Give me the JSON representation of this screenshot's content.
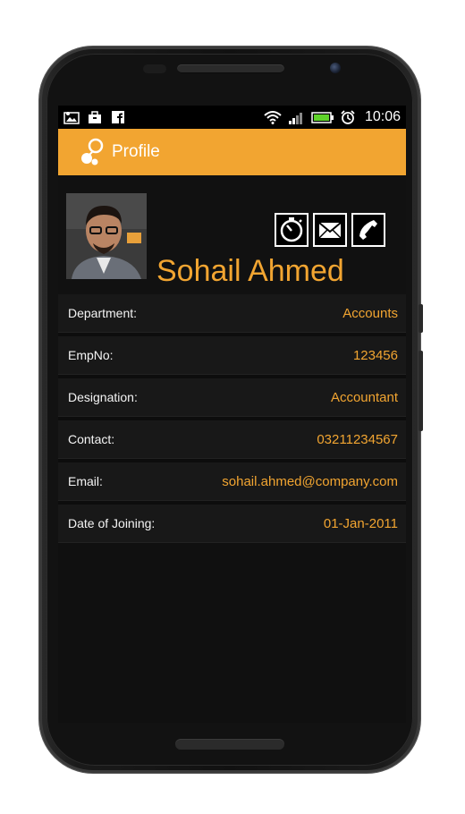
{
  "status_bar": {
    "time": "10:06",
    "left_icons": [
      "photo-notification-icon",
      "briefcase-notification-icon",
      "facebook-icon"
    ],
    "right_icons": [
      "wifi-icon",
      "signal-icon",
      "battery-icon",
      "alarm-icon"
    ]
  },
  "action_bar": {
    "title": "Profile",
    "color": "#f2a531"
  },
  "profile": {
    "name": "Sohail Ahmed",
    "actions": [
      "timer-icon",
      "email-icon",
      "phone-icon"
    ]
  },
  "details": [
    {
      "label": "Department:",
      "value": "Accounts"
    },
    {
      "label": "EmpNo:",
      "value": "123456"
    },
    {
      "label": "Designation:",
      "value": "Accountant"
    },
    {
      "label": "Contact:",
      "value": "03211234567"
    },
    {
      "label": "Email:",
      "value": "sohail.ahmed@company.com"
    },
    {
      "label": "Date of Joining:",
      "value": "01-Jan-2011"
    }
  ]
}
